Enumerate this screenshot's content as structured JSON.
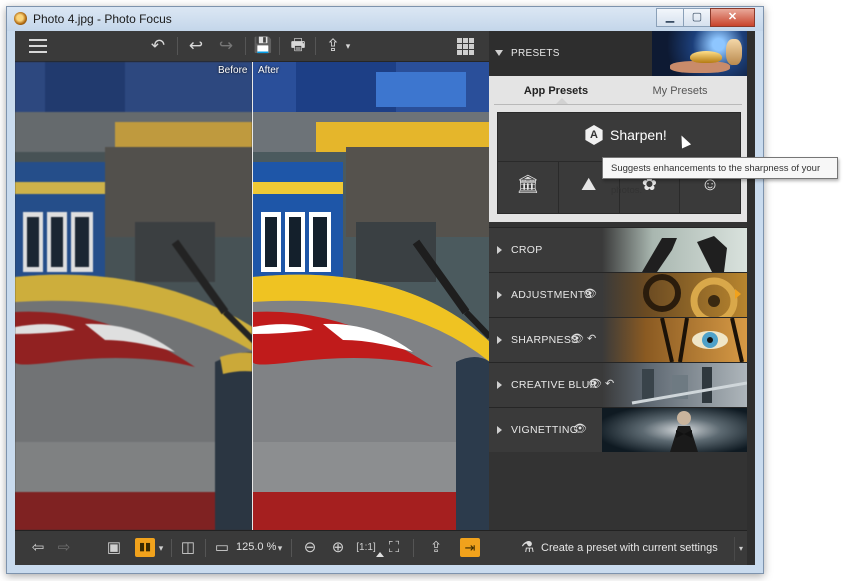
{
  "window": {
    "title": "Photo 4.jpg - Photo Focus",
    "controls": {
      "minimize": "▁",
      "maximize": "▢",
      "close": "✕"
    }
  },
  "toolbar": {
    "menu_icon": "hamburger-menu-icon",
    "undo_icon": "↶",
    "back_icon": "↩",
    "redo_icon": "↪",
    "save_icon": "💾",
    "print_icon": "🖶",
    "share_icon": "⇪",
    "share_caret": "▾",
    "grid_icon": "grid-view-icon"
  },
  "compare": {
    "before_label": "Before",
    "after_label": "After"
  },
  "bottom_bar": {
    "prev_icon": "⇦",
    "next_icon": "⇨",
    "single_view_icon": "▣",
    "compare_icon": "▮▮",
    "compare_caret": "▾",
    "split_icon": "◫",
    "fit_icon": "▭",
    "zoom_value": "125.0 %",
    "zoom_caret": "▾",
    "zoom_out_icon": "⊖",
    "zoom_in_icon": "⊕",
    "actual_size_icon": "[1:1]",
    "zoom_fit_icon": "⛶",
    "export_icon": "⇪",
    "exit_icon": "⇥"
  },
  "panel": {
    "presets": {
      "title": "PRESETS",
      "tabs": [
        {
          "label": "App Presets",
          "active": true
        },
        {
          "label": "My Presets",
          "active": false
        }
      ],
      "featured": {
        "badge": "A",
        "label": "Sharpen!"
      },
      "categories": [
        {
          "name": "architecture",
          "glyph": "🏛"
        },
        {
          "name": "landscape",
          "glyph": "⛰"
        },
        {
          "name": "nature",
          "glyph": "✿"
        },
        {
          "name": "portrait",
          "glyph": "☺"
        }
      ],
      "tooltip": "Suggests enhancements to the sharpness of your photos."
    },
    "sections": [
      {
        "label": "CROP",
        "eye": "",
        "reset": ""
      },
      {
        "label": "ADJUSTMENTS",
        "eye": "👁",
        "reset": ""
      },
      {
        "label": "SHARPNESS",
        "eye": "👁",
        "reset": "↶"
      },
      {
        "label": "CREATIVE BLUR",
        "eye": "👁",
        "reset": "↶"
      },
      {
        "label": "VIGNETTING",
        "eye": "👁",
        "reset": ""
      }
    ],
    "bottom": {
      "create_preset": "Create a preset with current settings",
      "dropdown": "▾"
    }
  },
  "colors": {
    "accent": "#f1a21c",
    "panel_bg": "#333333",
    "toolbar_bg": "#3a3a3a"
  }
}
